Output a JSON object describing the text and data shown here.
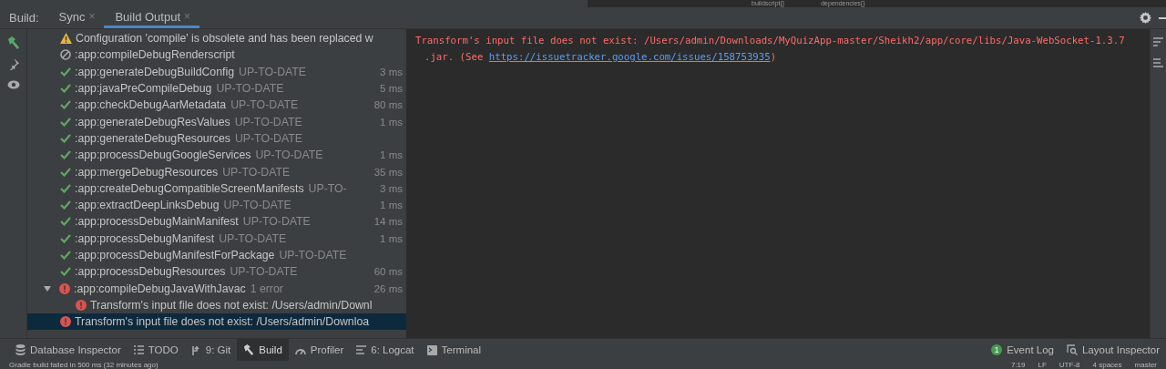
{
  "breadcrumbs": [
    "buildscript{}",
    "dependencies{}"
  ],
  "build_panel": {
    "label": "Build:",
    "tabs": [
      {
        "label": "Sync",
        "selected": false,
        "close": "×"
      },
      {
        "label": "Build Output",
        "selected": true,
        "close": "×"
      }
    ]
  },
  "tree": [
    {
      "kind": "warning",
      "name": "Configuration 'compile' is obsolete and has been replaced w",
      "selected": false
    },
    {
      "kind": "skipped",
      "name": ":app:compileDebugRenderscript",
      "selected": false
    },
    {
      "kind": "success",
      "name": ":app:generateDebugBuildConfig",
      "status": "UP-TO-DATE",
      "time": "3 ms",
      "selected": false
    },
    {
      "kind": "success",
      "name": ":app:javaPreCompileDebug",
      "status": "UP-TO-DATE",
      "time": "5 ms",
      "selected": false
    },
    {
      "kind": "success",
      "name": ":app:checkDebugAarMetadata",
      "status": "UP-TO-DATE",
      "time": "80 ms",
      "selected": false
    },
    {
      "kind": "success",
      "name": ":app:generateDebugResValues",
      "status": "UP-TO-DATE",
      "time": "1 ms",
      "selected": false
    },
    {
      "kind": "success",
      "name": ":app:generateDebugResources",
      "status": "UP-TO-DATE",
      "selected": false
    },
    {
      "kind": "success",
      "name": ":app:processDebugGoogleServices",
      "status": "UP-TO-DATE",
      "time": "1 ms",
      "selected": false
    },
    {
      "kind": "success",
      "name": ":app:mergeDebugResources",
      "status": "UP-TO-DATE",
      "time": "35 ms",
      "selected": false
    },
    {
      "kind": "success",
      "name": ":app:createDebugCompatibleScreenManifests",
      "status": "UP-TO-",
      "time": "3 ms",
      "selected": false
    },
    {
      "kind": "success",
      "name": ":app:extractDeepLinksDebug",
      "status": "UP-TO-DATE",
      "time": "1 ms",
      "selected": false
    },
    {
      "kind": "success",
      "name": ":app:processDebugMainManifest",
      "status": "UP-TO-DATE",
      "time": "14 ms",
      "selected": false
    },
    {
      "kind": "success",
      "name": ":app:processDebugManifest",
      "status": "UP-TO-DATE",
      "time": "1 ms",
      "selected": false
    },
    {
      "kind": "success",
      "name": ":app:processDebugManifestForPackage",
      "status": "UP-TO-DATE",
      "selected": false
    },
    {
      "kind": "success",
      "name": ":app:processDebugResources",
      "status": "UP-TO-DATE",
      "time": "60 ms",
      "selected": false
    },
    {
      "kind": "error",
      "name": ":app:compileDebugJavaWithJavac",
      "status": "1 error",
      "time": "26 ms",
      "selected": false,
      "expanded": true,
      "children": [
        {
          "kind": "error",
          "name": "Transform's input file does not exist: /Users/admin/Downl",
          "selected": false
        }
      ]
    },
    {
      "kind": "error",
      "name": "Transform's input file does not exist: /Users/admin/Downloa",
      "selected": true
    }
  ],
  "console": {
    "message": "Transform's input file does not exist: /Users/admin/Downloads/MyQuizApp-master/Sheikh2/app/core/libs/Java-WebSocket-1.3.7",
    "continuation": ".jar. (See ",
    "link": "https://issuetracker.google.com/issues/158753935",
    "closing": ")"
  },
  "tool_windows_left": [
    {
      "kind": "database",
      "label": "Database Inspector",
      "selected": false
    },
    {
      "kind": "todo",
      "label": "TODO",
      "selected": false
    },
    {
      "kind": "vcs",
      "label": "9: Git",
      "selected": false
    },
    {
      "kind": "build",
      "label": "Build",
      "selected": true
    },
    {
      "kind": "profiler",
      "label": "Profiler",
      "selected": false
    },
    {
      "kind": "logcat",
      "label": "6: Logcat",
      "selected": false
    },
    {
      "kind": "terminal",
      "label": "Terminal",
      "selected": false
    }
  ],
  "tool_windows_right": [
    {
      "kind": "log",
      "badge": "1",
      "label": "Event Log"
    },
    {
      "kind": "inspector",
      "label": "Layout Inspector"
    }
  ],
  "status_bar": {
    "message": "Gradle build failed in 500 ms (32 minutes ago)",
    "items": [
      "7:19",
      "LF",
      "UTF-8",
      "4 spaces",
      "master"
    ]
  }
}
